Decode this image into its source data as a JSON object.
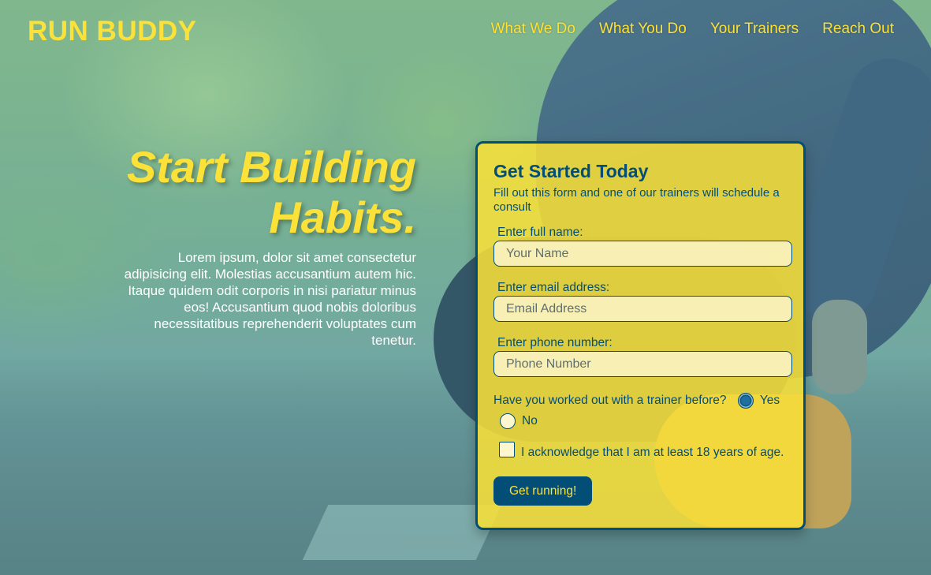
{
  "header": {
    "brand": "RUN BUDDY",
    "nav": [
      {
        "label": "What We Do"
      },
      {
        "label": "What You Do"
      },
      {
        "label": "Your Trainers"
      },
      {
        "label": "Reach Out"
      }
    ]
  },
  "hero": {
    "title": "Start Building Habits.",
    "description": "Lorem ipsum, dolor sit amet consectetur adipisicing elit. Molestias accusantium autem hic. Itaque quidem odit corporis in nisi pariatur minus eos! Accusantium quod nobis doloribus necessitatibus reprehenderit voluptates cum tenetur."
  },
  "form": {
    "title": "Get Started Today",
    "subtitle": "Fill out this form and one of our trainers will schedule a consult",
    "name_label": "Enter full name:",
    "name_placeholder": "Your Name",
    "email_label": "Enter email address:",
    "email_placeholder": "Email Address",
    "phone_label": "Enter phone number:",
    "phone_placeholder": "Phone Number",
    "trainer_question": "Have you worked out with a trainer before?",
    "yes_label": "Yes",
    "no_label": "No",
    "yes_selected": true,
    "ack_label": "I acknowledge that I am at least 18 years of age.",
    "ack_checked": false,
    "submit_label": "Get running!"
  },
  "colors": {
    "accent_yellow": "#fce138",
    "brand_blue": "#024e76"
  }
}
